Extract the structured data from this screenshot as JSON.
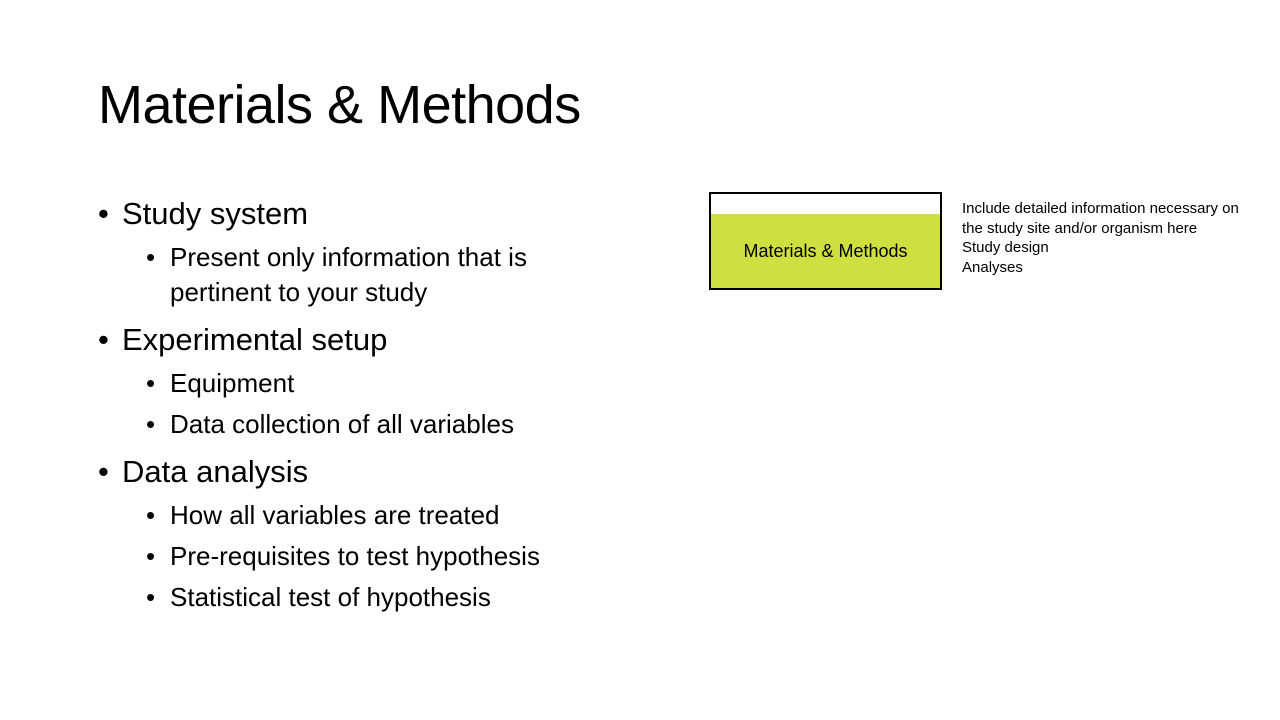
{
  "slide": {
    "title": "Materials & Methods",
    "accent_color": "#cfdf3f"
  },
  "bullets": [
    {
      "text": "Study system",
      "children": [
        "Present only information that is pertinent to your study"
      ]
    },
    {
      "text": "Experimental setup",
      "children": [
        "Equipment",
        "Data collection of all variables"
      ]
    },
    {
      "text": "Data analysis",
      "children": [
        "How all variables are treated",
        "Pre-requisites to test hypothesis",
        "Statistical test of hypothesis"
      ]
    }
  ],
  "bullet_glyph": "•",
  "diagram": {
    "box_label": "Materials & Methods",
    "notes": [
      "Include detailed information necessary on",
      "the study site and/or organism here",
      "Study design",
      "Analyses"
    ]
  }
}
